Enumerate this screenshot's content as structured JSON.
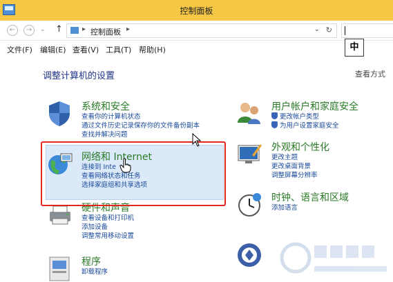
{
  "window": {
    "title": "控制面板"
  },
  "address": {
    "breadcrumb": "控制面板",
    "search_placeholder": ""
  },
  "menu": [
    "文件(F)",
    "编辑(E)",
    "查看(V)",
    "工具(T)",
    "帮助(H)"
  ],
  "ime": "中",
  "heading": "调整计算机的设置",
  "view_by": "查看方式",
  "categories": [
    {
      "title": "系统和安全",
      "links": [
        "查看你的计算机状态",
        "通过文件历史记录保存你的文件备份副本",
        "查找并解决问题"
      ]
    },
    {
      "title": "网络和 Internet",
      "links": [
        "连接到 Inte",
        "查看网络状态和任务",
        "选择家庭组和共享选项"
      ]
    },
    {
      "title": "硬件和声音",
      "links": [
        "查看设备和打印机",
        "添加设备",
        "调整常用移动设置"
      ]
    },
    {
      "title": "程序",
      "links": [
        "卸载程序"
      ]
    },
    {
      "title": "用户帐户和家庭安全",
      "links": [
        "更改帐户类型",
        "为用户设置家庭安全"
      ]
    },
    {
      "title": "外观和个性化",
      "links": [
        "更改主题",
        "更改桌面背景",
        "调整屏幕分辨率"
      ]
    },
    {
      "title": "时钟、语言和区域",
      "links": [
        "添加语言"
      ]
    }
  ],
  "colors": {
    "titlebar": "#f6c645",
    "category_title": "#2a7a27",
    "link": "#1a4a9b",
    "heading": "#1e3287",
    "highlight_border": "#e0261e"
  }
}
